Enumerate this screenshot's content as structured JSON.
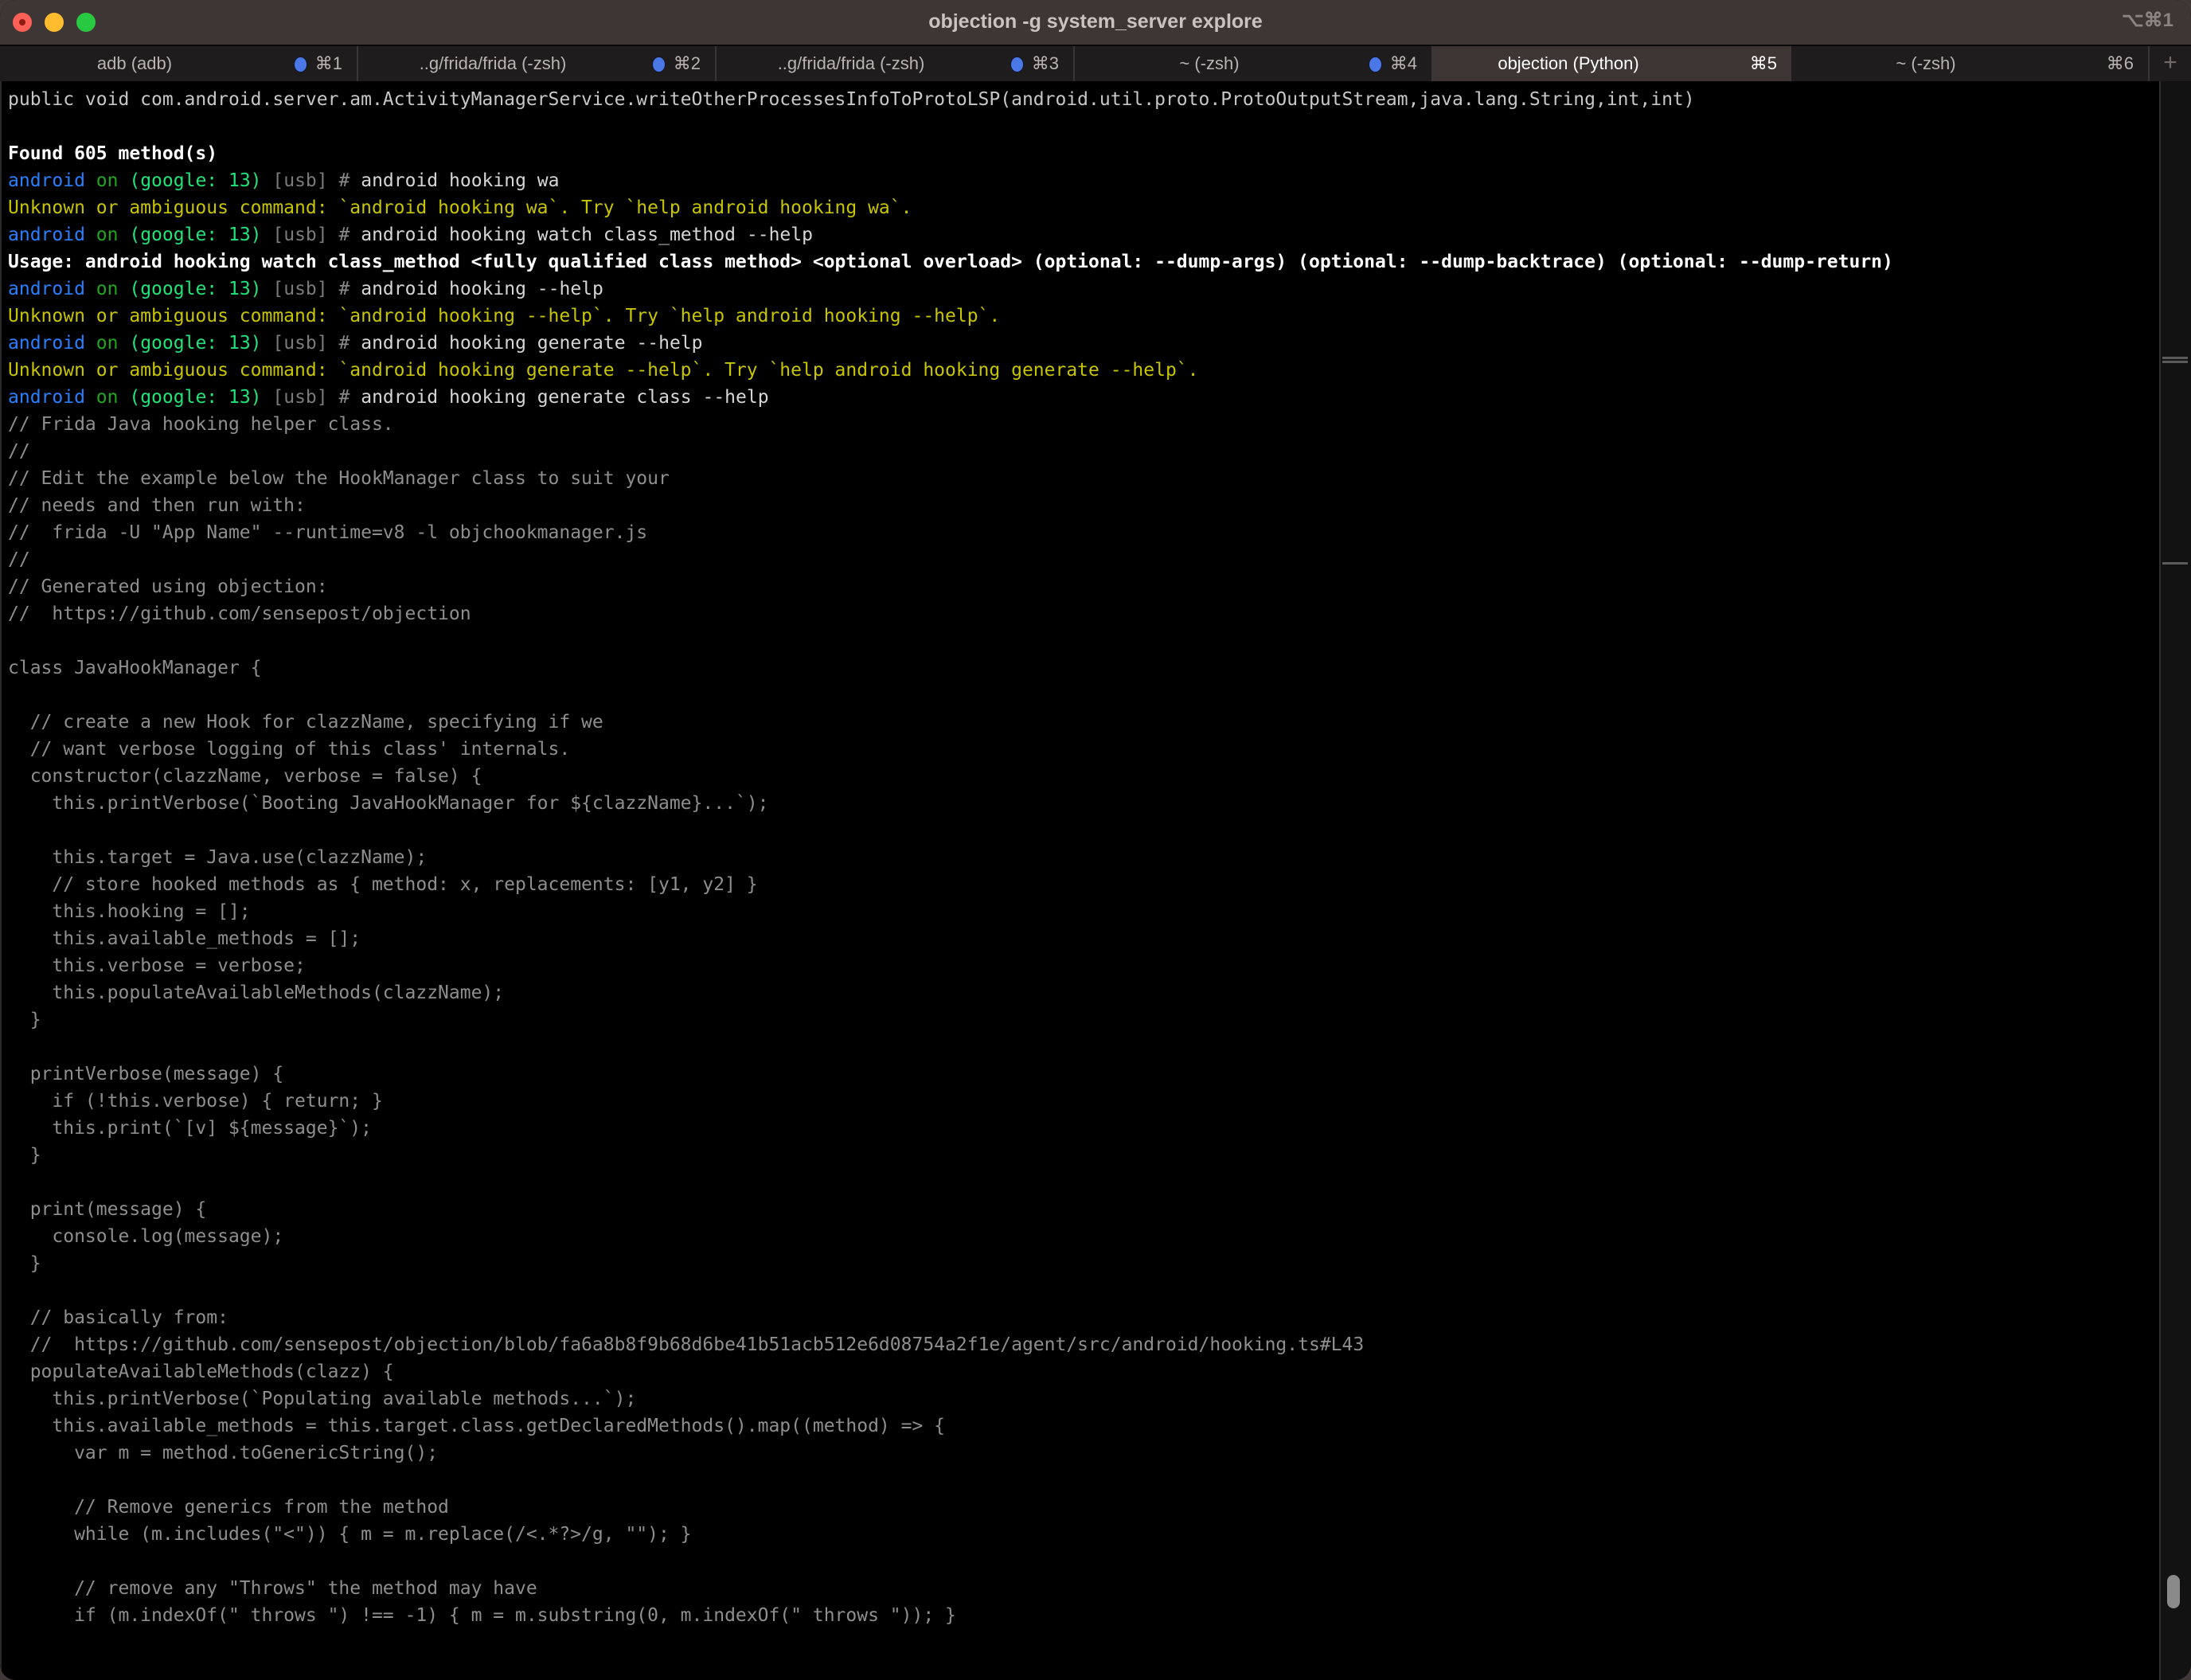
{
  "window": {
    "title": "objection -g system_server explore",
    "shortcut": "⌥⌘1"
  },
  "tabs": [
    {
      "label": "adb (adb)",
      "key": "⌘1",
      "activity": true,
      "active": false
    },
    {
      "label": "..g/frida/frida (-zsh)",
      "key": "⌘2",
      "activity": true,
      "active": false
    },
    {
      "label": "..g/frida/frida (-zsh)",
      "key": "⌘3",
      "activity": true,
      "active": false
    },
    {
      "label": "~ (-zsh)",
      "key": "⌘4",
      "activity": true,
      "active": false
    },
    {
      "label": "objection (Python)",
      "key": "⌘5",
      "activity": false,
      "active": true
    },
    {
      "label": "~ (-zsh)",
      "key": "⌘6",
      "activity": false,
      "active": false
    }
  ],
  "new_tab_label": "+",
  "colors": {
    "prompt_device": "#2a7fff",
    "prompt_on": "#1fa51f",
    "prompt_target": "#22e37a",
    "warning": "#c7c400",
    "code": "#8e8e8e",
    "tab_activity_dot": "#4a78e6"
  },
  "prompt": {
    "device": "android",
    "on": "on",
    "target": "(google: 13)",
    "transport": "[usb]",
    "hash": "#"
  },
  "terminal_lines": [
    {
      "type": "plain",
      "text": "public void com.android.server.am.ActivityManagerService.writeOtherProcessesInfoToProtoLSP(android.util.proto.ProtoOutputStream,java.lang.String,int,int)"
    },
    {
      "type": "blank",
      "text": ""
    },
    {
      "type": "bold",
      "text": "Found 605 method(s)"
    },
    {
      "type": "prompt",
      "text": "android hooking wa"
    },
    {
      "type": "warn",
      "text": "Unknown or ambiguous command: `android hooking wa`. Try `help android hooking wa`."
    },
    {
      "type": "prompt",
      "text": "android hooking watch class_method --help"
    },
    {
      "type": "bold",
      "text": "Usage: android hooking watch class_method <fully qualified class method> <optional overload> (optional: --dump-args) (optional: --dump-backtrace) (optional: --dump-return)"
    },
    {
      "type": "prompt",
      "text": "android hooking --help"
    },
    {
      "type": "warn",
      "text": "Unknown or ambiguous command: `android hooking --help`. Try `help android hooking --help`."
    },
    {
      "type": "prompt",
      "text": "android hooking generate --help"
    },
    {
      "type": "warn",
      "text": "Unknown or ambiguous command: `android hooking generate --help`. Try `help android hooking generate --help`."
    },
    {
      "type": "prompt",
      "text": "android hooking generate class --help"
    },
    {
      "type": "code",
      "text": "// Frida Java hooking helper class."
    },
    {
      "type": "code",
      "text": "//"
    },
    {
      "type": "code",
      "text": "// Edit the example below the HookManager class to suit your"
    },
    {
      "type": "code",
      "text": "// needs and then run with:"
    },
    {
      "type": "code",
      "text": "//  frida -U \"App Name\" --runtime=v8 -l objchookmanager.js"
    },
    {
      "type": "code",
      "text": "//"
    },
    {
      "type": "code",
      "text": "// Generated using objection:"
    },
    {
      "type": "code",
      "text": "//  https://github.com/sensepost/objection"
    },
    {
      "type": "code",
      "text": ""
    },
    {
      "type": "code",
      "text": "class JavaHookManager {"
    },
    {
      "type": "code",
      "text": ""
    },
    {
      "type": "code",
      "text": "  // create a new Hook for clazzName, specifying if we"
    },
    {
      "type": "code",
      "text": "  // want verbose logging of this class' internals."
    },
    {
      "type": "code",
      "text": "  constructor(clazzName, verbose = false) {"
    },
    {
      "type": "code",
      "text": "    this.printVerbose(`Booting JavaHookManager for ${clazzName}...`);"
    },
    {
      "type": "code",
      "text": ""
    },
    {
      "type": "code",
      "text": "    this.target = Java.use(clazzName);"
    },
    {
      "type": "code",
      "text": "    // store hooked methods as { method: x, replacements: [y1, y2] }"
    },
    {
      "type": "code",
      "text": "    this.hooking = [];"
    },
    {
      "type": "code",
      "text": "    this.available_methods = [];"
    },
    {
      "type": "code",
      "text": "    this.verbose = verbose;"
    },
    {
      "type": "code",
      "text": "    this.populateAvailableMethods(clazzName);"
    },
    {
      "type": "code",
      "text": "  }"
    },
    {
      "type": "code",
      "text": ""
    },
    {
      "type": "code",
      "text": "  printVerbose(message) {"
    },
    {
      "type": "code",
      "text": "    if (!this.verbose) { return; }"
    },
    {
      "type": "code",
      "text": "    this.print(`[v] ${message}`);"
    },
    {
      "type": "code",
      "text": "  }"
    },
    {
      "type": "code",
      "text": ""
    },
    {
      "type": "code",
      "text": "  print(message) {"
    },
    {
      "type": "code",
      "text": "    console.log(message);"
    },
    {
      "type": "code",
      "text": "  }"
    },
    {
      "type": "code",
      "text": ""
    },
    {
      "type": "code",
      "text": "  // basically from:"
    },
    {
      "type": "code",
      "text": "  //  https://github.com/sensepost/objection/blob/fa6a8b8f9b68d6be41b51acb512e6d08754a2f1e/agent/src/android/hooking.ts#L43"
    },
    {
      "type": "code",
      "text": "  populateAvailableMethods(clazz) {"
    },
    {
      "type": "code",
      "text": "    this.printVerbose(`Populating available methods...`);"
    },
    {
      "type": "code",
      "text": "    this.available_methods = this.target.class.getDeclaredMethods().map((method) => {"
    },
    {
      "type": "code",
      "text": "      var m = method.toGenericString();"
    },
    {
      "type": "code",
      "text": ""
    },
    {
      "type": "code",
      "text": "      // Remove generics from the method"
    },
    {
      "type": "code",
      "text": "      while (m.includes(\"<\")) { m = m.replace(/<.*?>/g, \"\"); }"
    },
    {
      "type": "code",
      "text": ""
    },
    {
      "type": "code",
      "text": "      // remove any \"Throws\" the method may have"
    },
    {
      "type": "code",
      "text": "      if (m.indexOf(\" throws \") !== -1) { m = m.substring(0, m.indexOf(\" throws \")); }"
    }
  ]
}
